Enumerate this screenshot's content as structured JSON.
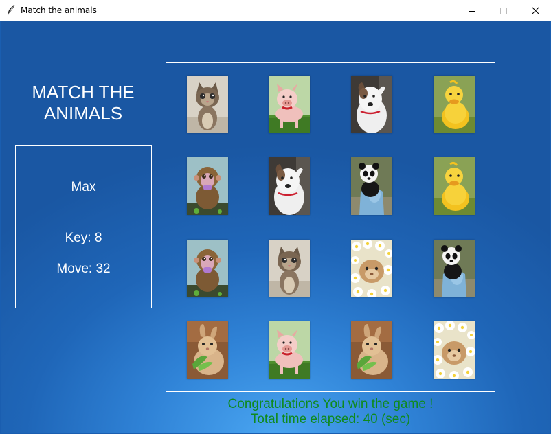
{
  "window": {
    "title": "Match the animals"
  },
  "game": {
    "title_line1": "MATCH THE",
    "title_line2": "ANIMALS",
    "player_name": "Max",
    "key_text": "Key: 8",
    "move_text": "Move: 32"
  },
  "board": {
    "rows": [
      [
        "kitten",
        "pig",
        "dog",
        "duckling"
      ],
      [
        "monkey",
        "dog",
        "panda",
        "duckling"
      ],
      [
        "monkey",
        "kitten",
        "guinea-pig",
        "panda"
      ],
      [
        "bunny",
        "pig",
        "bunny",
        "guinea-pig"
      ]
    ]
  },
  "message": {
    "line1": "Congratulations You win the game !",
    "line2": "Total time elapsed: 40 (sec)"
  },
  "colors": {
    "message": "#0f8a1e",
    "background": "#1a5eb0",
    "text": "#ffffff"
  }
}
